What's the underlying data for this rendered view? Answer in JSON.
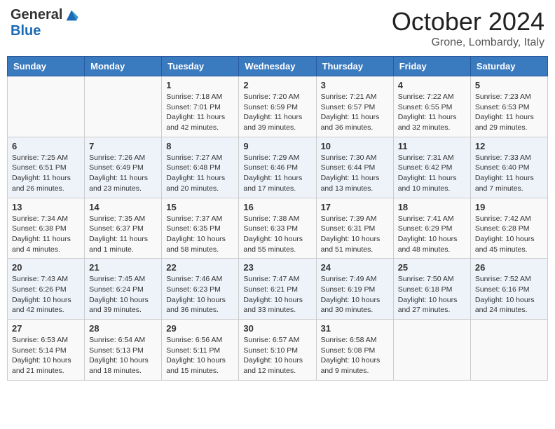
{
  "header": {
    "logo_general": "General",
    "logo_blue": "Blue",
    "title": "October 2024",
    "location": "Grone, Lombardy, Italy"
  },
  "days_of_week": [
    "Sunday",
    "Monday",
    "Tuesday",
    "Wednesday",
    "Thursday",
    "Friday",
    "Saturday"
  ],
  "weeks": [
    [
      {
        "day": "",
        "content": ""
      },
      {
        "day": "",
        "content": ""
      },
      {
        "day": "1",
        "content": "Sunrise: 7:18 AM\nSunset: 7:01 PM\nDaylight: 11 hours and 42 minutes."
      },
      {
        "day": "2",
        "content": "Sunrise: 7:20 AM\nSunset: 6:59 PM\nDaylight: 11 hours and 39 minutes."
      },
      {
        "day": "3",
        "content": "Sunrise: 7:21 AM\nSunset: 6:57 PM\nDaylight: 11 hours and 36 minutes."
      },
      {
        "day": "4",
        "content": "Sunrise: 7:22 AM\nSunset: 6:55 PM\nDaylight: 11 hours and 32 minutes."
      },
      {
        "day": "5",
        "content": "Sunrise: 7:23 AM\nSunset: 6:53 PM\nDaylight: 11 hours and 29 minutes."
      }
    ],
    [
      {
        "day": "6",
        "content": "Sunrise: 7:25 AM\nSunset: 6:51 PM\nDaylight: 11 hours and 26 minutes."
      },
      {
        "day": "7",
        "content": "Sunrise: 7:26 AM\nSunset: 6:49 PM\nDaylight: 11 hours and 23 minutes."
      },
      {
        "day": "8",
        "content": "Sunrise: 7:27 AM\nSunset: 6:48 PM\nDaylight: 11 hours and 20 minutes."
      },
      {
        "day": "9",
        "content": "Sunrise: 7:29 AM\nSunset: 6:46 PM\nDaylight: 11 hours and 17 minutes."
      },
      {
        "day": "10",
        "content": "Sunrise: 7:30 AM\nSunset: 6:44 PM\nDaylight: 11 hours and 13 minutes."
      },
      {
        "day": "11",
        "content": "Sunrise: 7:31 AM\nSunset: 6:42 PM\nDaylight: 11 hours and 10 minutes."
      },
      {
        "day": "12",
        "content": "Sunrise: 7:33 AM\nSunset: 6:40 PM\nDaylight: 11 hours and 7 minutes."
      }
    ],
    [
      {
        "day": "13",
        "content": "Sunrise: 7:34 AM\nSunset: 6:38 PM\nDaylight: 11 hours and 4 minutes."
      },
      {
        "day": "14",
        "content": "Sunrise: 7:35 AM\nSunset: 6:37 PM\nDaylight: 11 hours and 1 minute."
      },
      {
        "day": "15",
        "content": "Sunrise: 7:37 AM\nSunset: 6:35 PM\nDaylight: 10 hours and 58 minutes."
      },
      {
        "day": "16",
        "content": "Sunrise: 7:38 AM\nSunset: 6:33 PM\nDaylight: 10 hours and 55 minutes."
      },
      {
        "day": "17",
        "content": "Sunrise: 7:39 AM\nSunset: 6:31 PM\nDaylight: 10 hours and 51 minutes."
      },
      {
        "day": "18",
        "content": "Sunrise: 7:41 AM\nSunset: 6:29 PM\nDaylight: 10 hours and 48 minutes."
      },
      {
        "day": "19",
        "content": "Sunrise: 7:42 AM\nSunset: 6:28 PM\nDaylight: 10 hours and 45 minutes."
      }
    ],
    [
      {
        "day": "20",
        "content": "Sunrise: 7:43 AM\nSunset: 6:26 PM\nDaylight: 10 hours and 42 minutes."
      },
      {
        "day": "21",
        "content": "Sunrise: 7:45 AM\nSunset: 6:24 PM\nDaylight: 10 hours and 39 minutes."
      },
      {
        "day": "22",
        "content": "Sunrise: 7:46 AM\nSunset: 6:23 PM\nDaylight: 10 hours and 36 minutes."
      },
      {
        "day": "23",
        "content": "Sunrise: 7:47 AM\nSunset: 6:21 PM\nDaylight: 10 hours and 33 minutes."
      },
      {
        "day": "24",
        "content": "Sunrise: 7:49 AM\nSunset: 6:19 PM\nDaylight: 10 hours and 30 minutes."
      },
      {
        "day": "25",
        "content": "Sunrise: 7:50 AM\nSunset: 6:18 PM\nDaylight: 10 hours and 27 minutes."
      },
      {
        "day": "26",
        "content": "Sunrise: 7:52 AM\nSunset: 6:16 PM\nDaylight: 10 hours and 24 minutes."
      }
    ],
    [
      {
        "day": "27",
        "content": "Sunrise: 6:53 AM\nSunset: 5:14 PM\nDaylight: 10 hours and 21 minutes."
      },
      {
        "day": "28",
        "content": "Sunrise: 6:54 AM\nSunset: 5:13 PM\nDaylight: 10 hours and 18 minutes."
      },
      {
        "day": "29",
        "content": "Sunrise: 6:56 AM\nSunset: 5:11 PM\nDaylight: 10 hours and 15 minutes."
      },
      {
        "day": "30",
        "content": "Sunrise: 6:57 AM\nSunset: 5:10 PM\nDaylight: 10 hours and 12 minutes."
      },
      {
        "day": "31",
        "content": "Sunrise: 6:58 AM\nSunset: 5:08 PM\nDaylight: 10 hours and 9 minutes."
      },
      {
        "day": "",
        "content": ""
      },
      {
        "day": "",
        "content": ""
      }
    ]
  ]
}
